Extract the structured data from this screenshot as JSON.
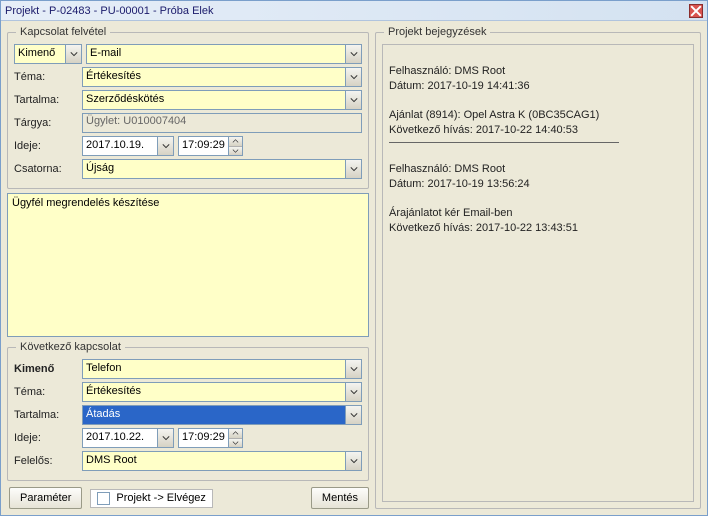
{
  "window": {
    "title": "Projekt - P-02483 - PU-00001 - Próba Elek"
  },
  "contact_section": {
    "legend": "Kapcsolat felvétel",
    "direction": "Kimenő",
    "channel_type": "E-mail",
    "topic_label": "Téma:",
    "topic": "Értékesítés",
    "content_label": "Tartalma:",
    "content": "Szerződéskötés",
    "subject_label": "Tárgya:",
    "subject": "Ügylet: U010007404",
    "time_label": "Ideje:",
    "date": "2017.10.19.",
    "time": "17:09:29",
    "medium_label": "Csatorna:",
    "medium": "Újság",
    "note": "Ügyfél megrendelés készítése"
  },
  "next_section": {
    "legend": "Következő kapcsolat",
    "direction_label": "Kimenő",
    "direction_value": "Telefon",
    "topic_label": "Téma:",
    "topic": "Értékesítés",
    "content_label": "Tartalma:",
    "content": "Átadás",
    "time_label": "Ideje:",
    "date": "2017.10.22.",
    "time": "17:09:29",
    "owner_label": "Felelős:",
    "owner": "DMS Root"
  },
  "buttons": {
    "parameter": "Paraméter",
    "save": "Mentés",
    "complete_checkbox": "Projekt -> Elvégez"
  },
  "entries_section": {
    "legend": "Projekt bejegyzések",
    "block1_user_label": "Felhasználó: DMS Root",
    "block1_date": "Dátum: 2017-10-19 14:41:36",
    "block1_line1": "Ajánlat (8914): Opel Astra K (0BC35CAG1)",
    "block1_line2": "Következő hívás: 2017-10-22 14:40:53",
    "block2_user_label": "Felhasználó: DMS Root",
    "block2_date": "Dátum: 2017-10-19 13:56:24",
    "block2_line1": "Árajánlatot kér Email-ben",
    "block2_line2": "Következő hívás: 2017-10-22 13:43:51"
  }
}
